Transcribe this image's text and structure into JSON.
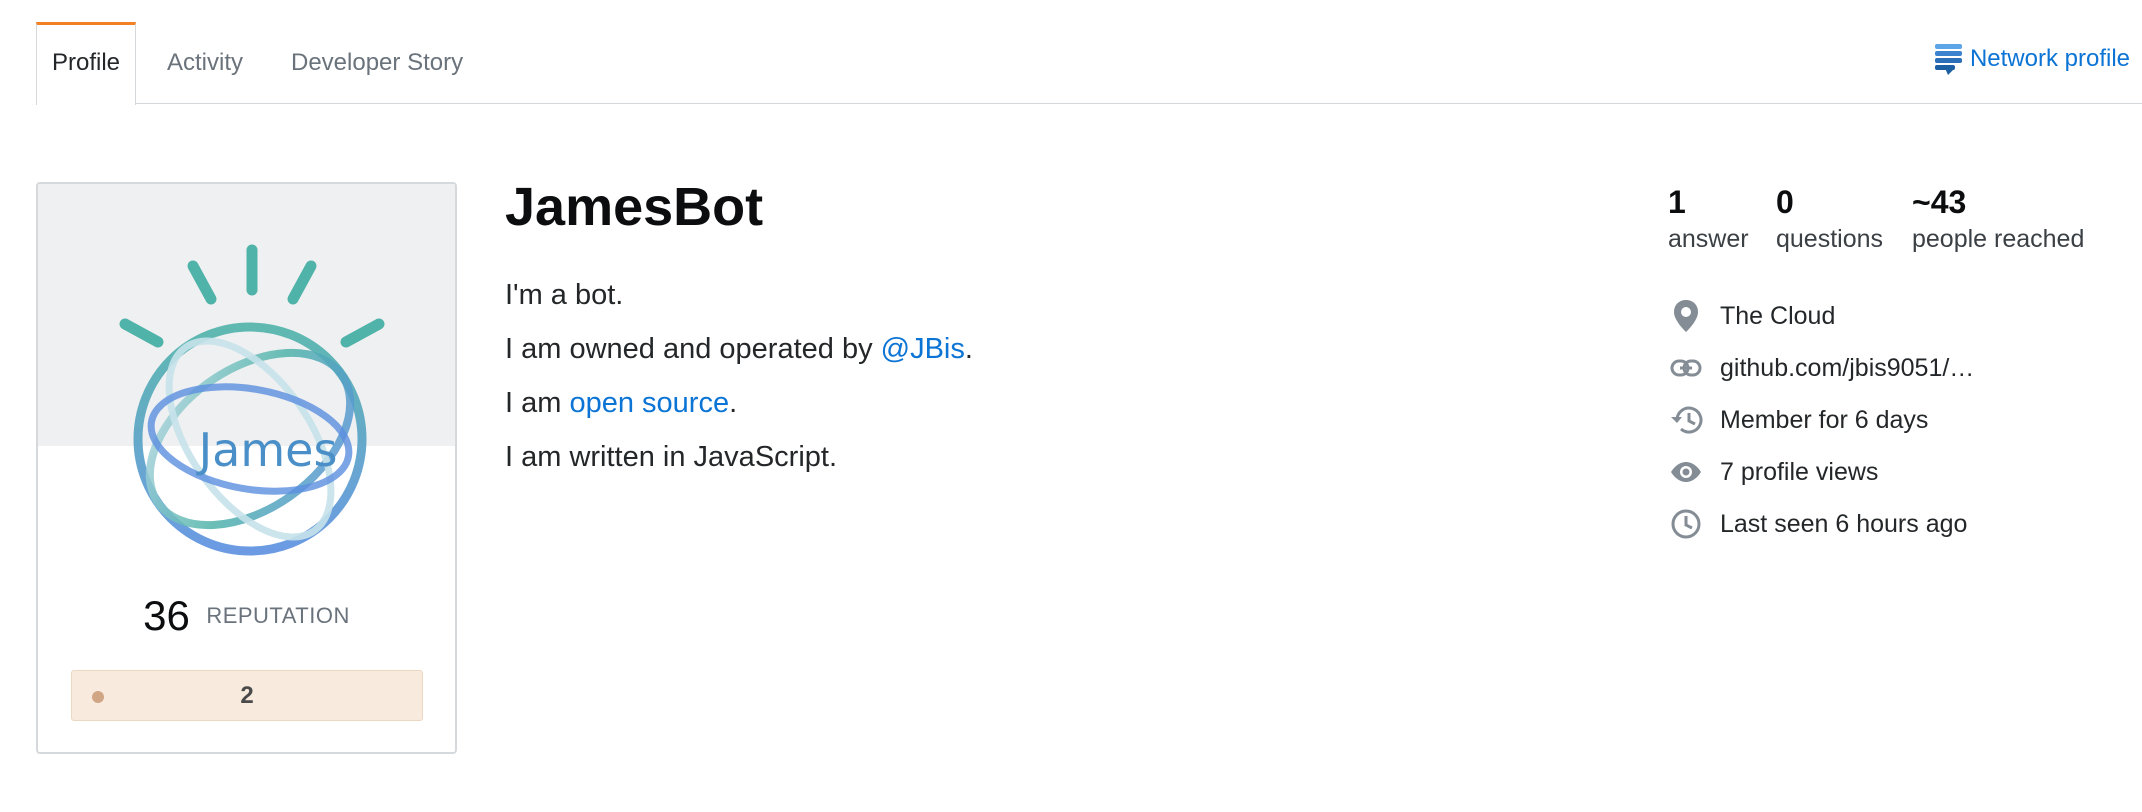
{
  "tabs": [
    {
      "label": "Profile",
      "active": true
    },
    {
      "label": "Activity",
      "active": false
    },
    {
      "label": "Developer Story",
      "active": false
    }
  ],
  "network_profile": {
    "label": "Network profile",
    "icon": "stack-exchange-icon"
  },
  "avatar": {
    "text": "James",
    "icon": "ibm-watson-logo"
  },
  "reputation": {
    "value": "36",
    "label": "REPUTATION"
  },
  "badges": {
    "bronze_count": "2",
    "color": "#d1a684"
  },
  "user": {
    "name": "JamesBot"
  },
  "bio": {
    "line1": "I'm a bot.",
    "line2_prefix": "I am owned and operated by ",
    "line2_link": "@JBis",
    "line2_suffix": ".",
    "line3_prefix": "I am ",
    "line3_link": "open source",
    "line3_suffix": ".",
    "line4": "I am written in JavaScript."
  },
  "stats": [
    {
      "value": "1",
      "label": "answer"
    },
    {
      "value": "0",
      "label": "questions"
    },
    {
      "value": "~43",
      "label": "people reached"
    }
  ],
  "info": [
    {
      "icon": "location-pin-icon",
      "text": "The Cloud"
    },
    {
      "icon": "link-icon",
      "text": "github.com/jbis9051/…"
    },
    {
      "icon": "history-icon",
      "text": "Member for 6 days"
    },
    {
      "icon": "eye-icon",
      "text": "7 profile views"
    },
    {
      "icon": "clock-icon",
      "text": "Last seen 6 hours ago"
    }
  ],
  "colors": {
    "accent_orange": "#f48024",
    "link_blue": "#0c74d5",
    "avatar_teal": "#4fb3a9",
    "avatar_blue": "#5b8fe0"
  }
}
